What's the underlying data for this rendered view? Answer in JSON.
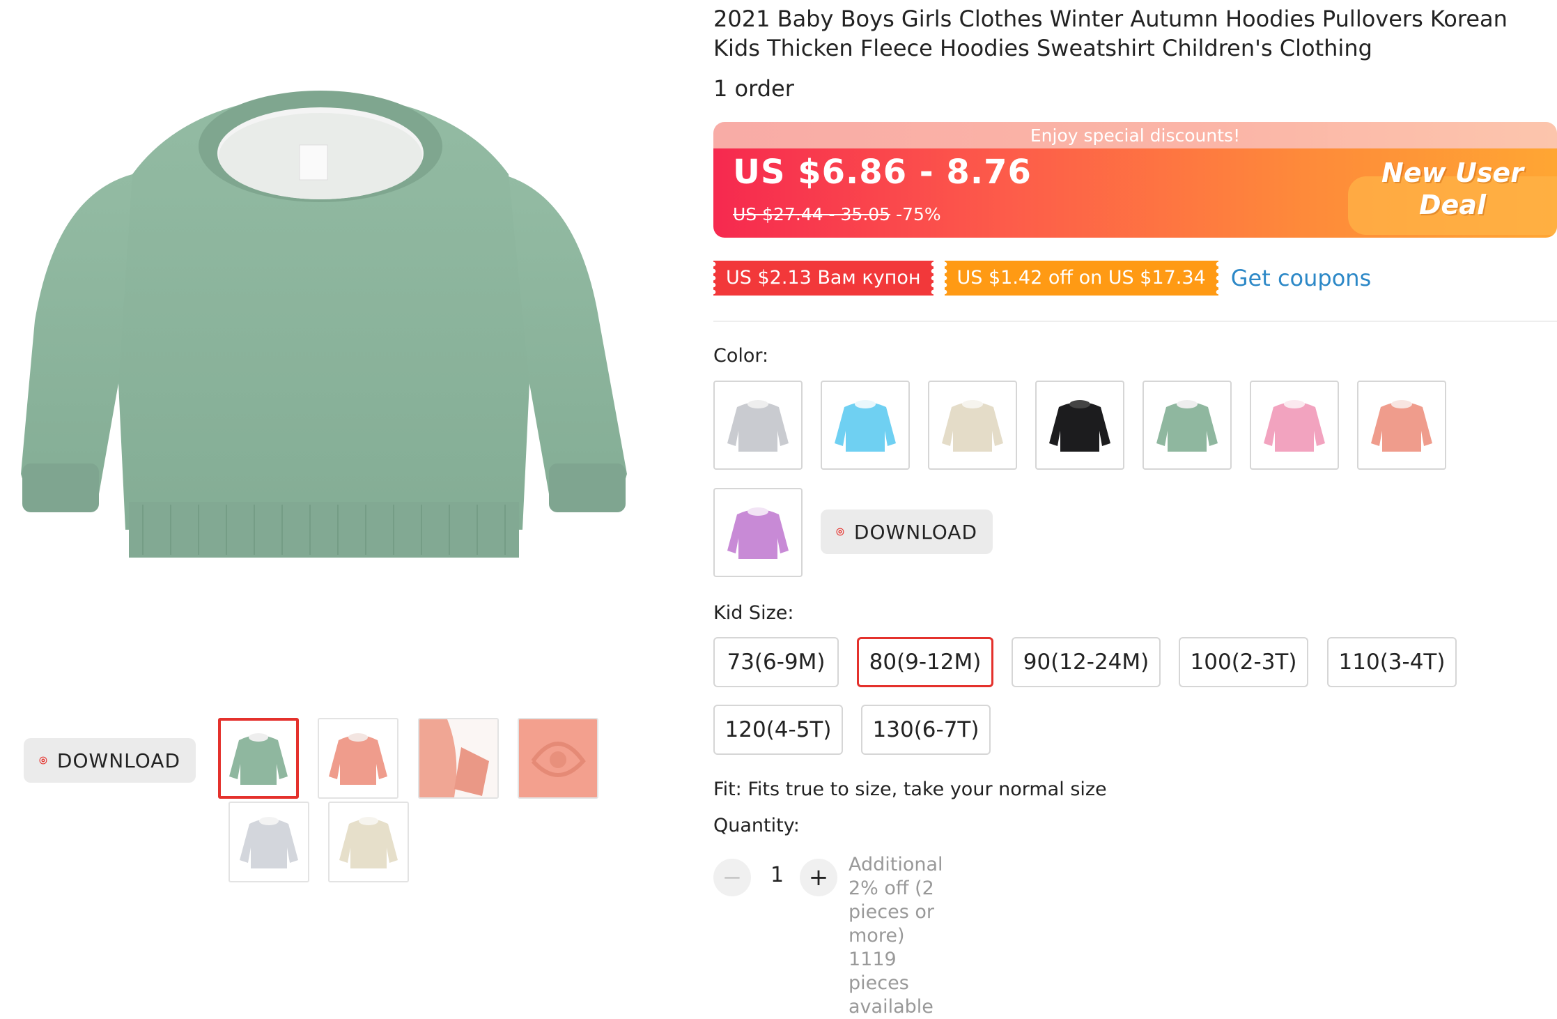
{
  "product": {
    "title": "2021 Baby Boys Girls Clothes Winter Autumn Hoodies Pullovers Korean Kids Thicken Fleece Hoodies Sweatshirt Children's Clothing",
    "orders": "1 order"
  },
  "price": {
    "banner": "Enjoy special discounts!",
    "current": "US $6.86 - 8.76",
    "original": "US $27.44 - 35.05",
    "discount": "-75%",
    "deal_line1": "New User",
    "deal_line2": "Deal"
  },
  "coupons": {
    "coupon1": "US $2.13 Вам купон",
    "coupon2": "US $1.42 off on US $17.34",
    "get_link": "Get coupons"
  },
  "download_label": "DOWNLOAD",
  "color": {
    "label": "Color:",
    "options": [
      {
        "name": "gray",
        "hex": "#c9cbd0"
      },
      {
        "name": "sky-blue",
        "hex": "#6fd0f2"
      },
      {
        "name": "beige",
        "hex": "#e4dcc8"
      },
      {
        "name": "black",
        "hex": "#1c1c1e"
      },
      {
        "name": "green",
        "hex": "#8fb79f"
      },
      {
        "name": "pink",
        "hex": "#f2a3bf"
      },
      {
        "name": "coral",
        "hex": "#ef9c8c"
      },
      {
        "name": "purple",
        "hex": "#c88ad6"
      }
    ]
  },
  "size": {
    "label": "Kid Size:",
    "options": [
      "73(6-9M)",
      "80(9-12M)",
      "90(12-24M)",
      "100(2-3T)",
      "110(3-4T)",
      "120(4-5T)",
      "130(6-7T)"
    ],
    "selected": "80(9-12M)"
  },
  "fit": "Fit: Fits true to size, take your normal size",
  "quantity": {
    "label": "Quantity:",
    "value": "1",
    "minus": "−",
    "plus": "+",
    "note1": "Additional 2% off (2 pieces or more)",
    "note2": "1119 pieces available"
  },
  "gallery": {
    "main_color": "#8fb79f",
    "thumbs": [
      "green",
      "coral",
      "pink-detail",
      "pink-fabric",
      "gray",
      "beige"
    ]
  },
  "colors": {
    "accent_red": "#e4312c",
    "link_blue": "#2c88c7"
  }
}
